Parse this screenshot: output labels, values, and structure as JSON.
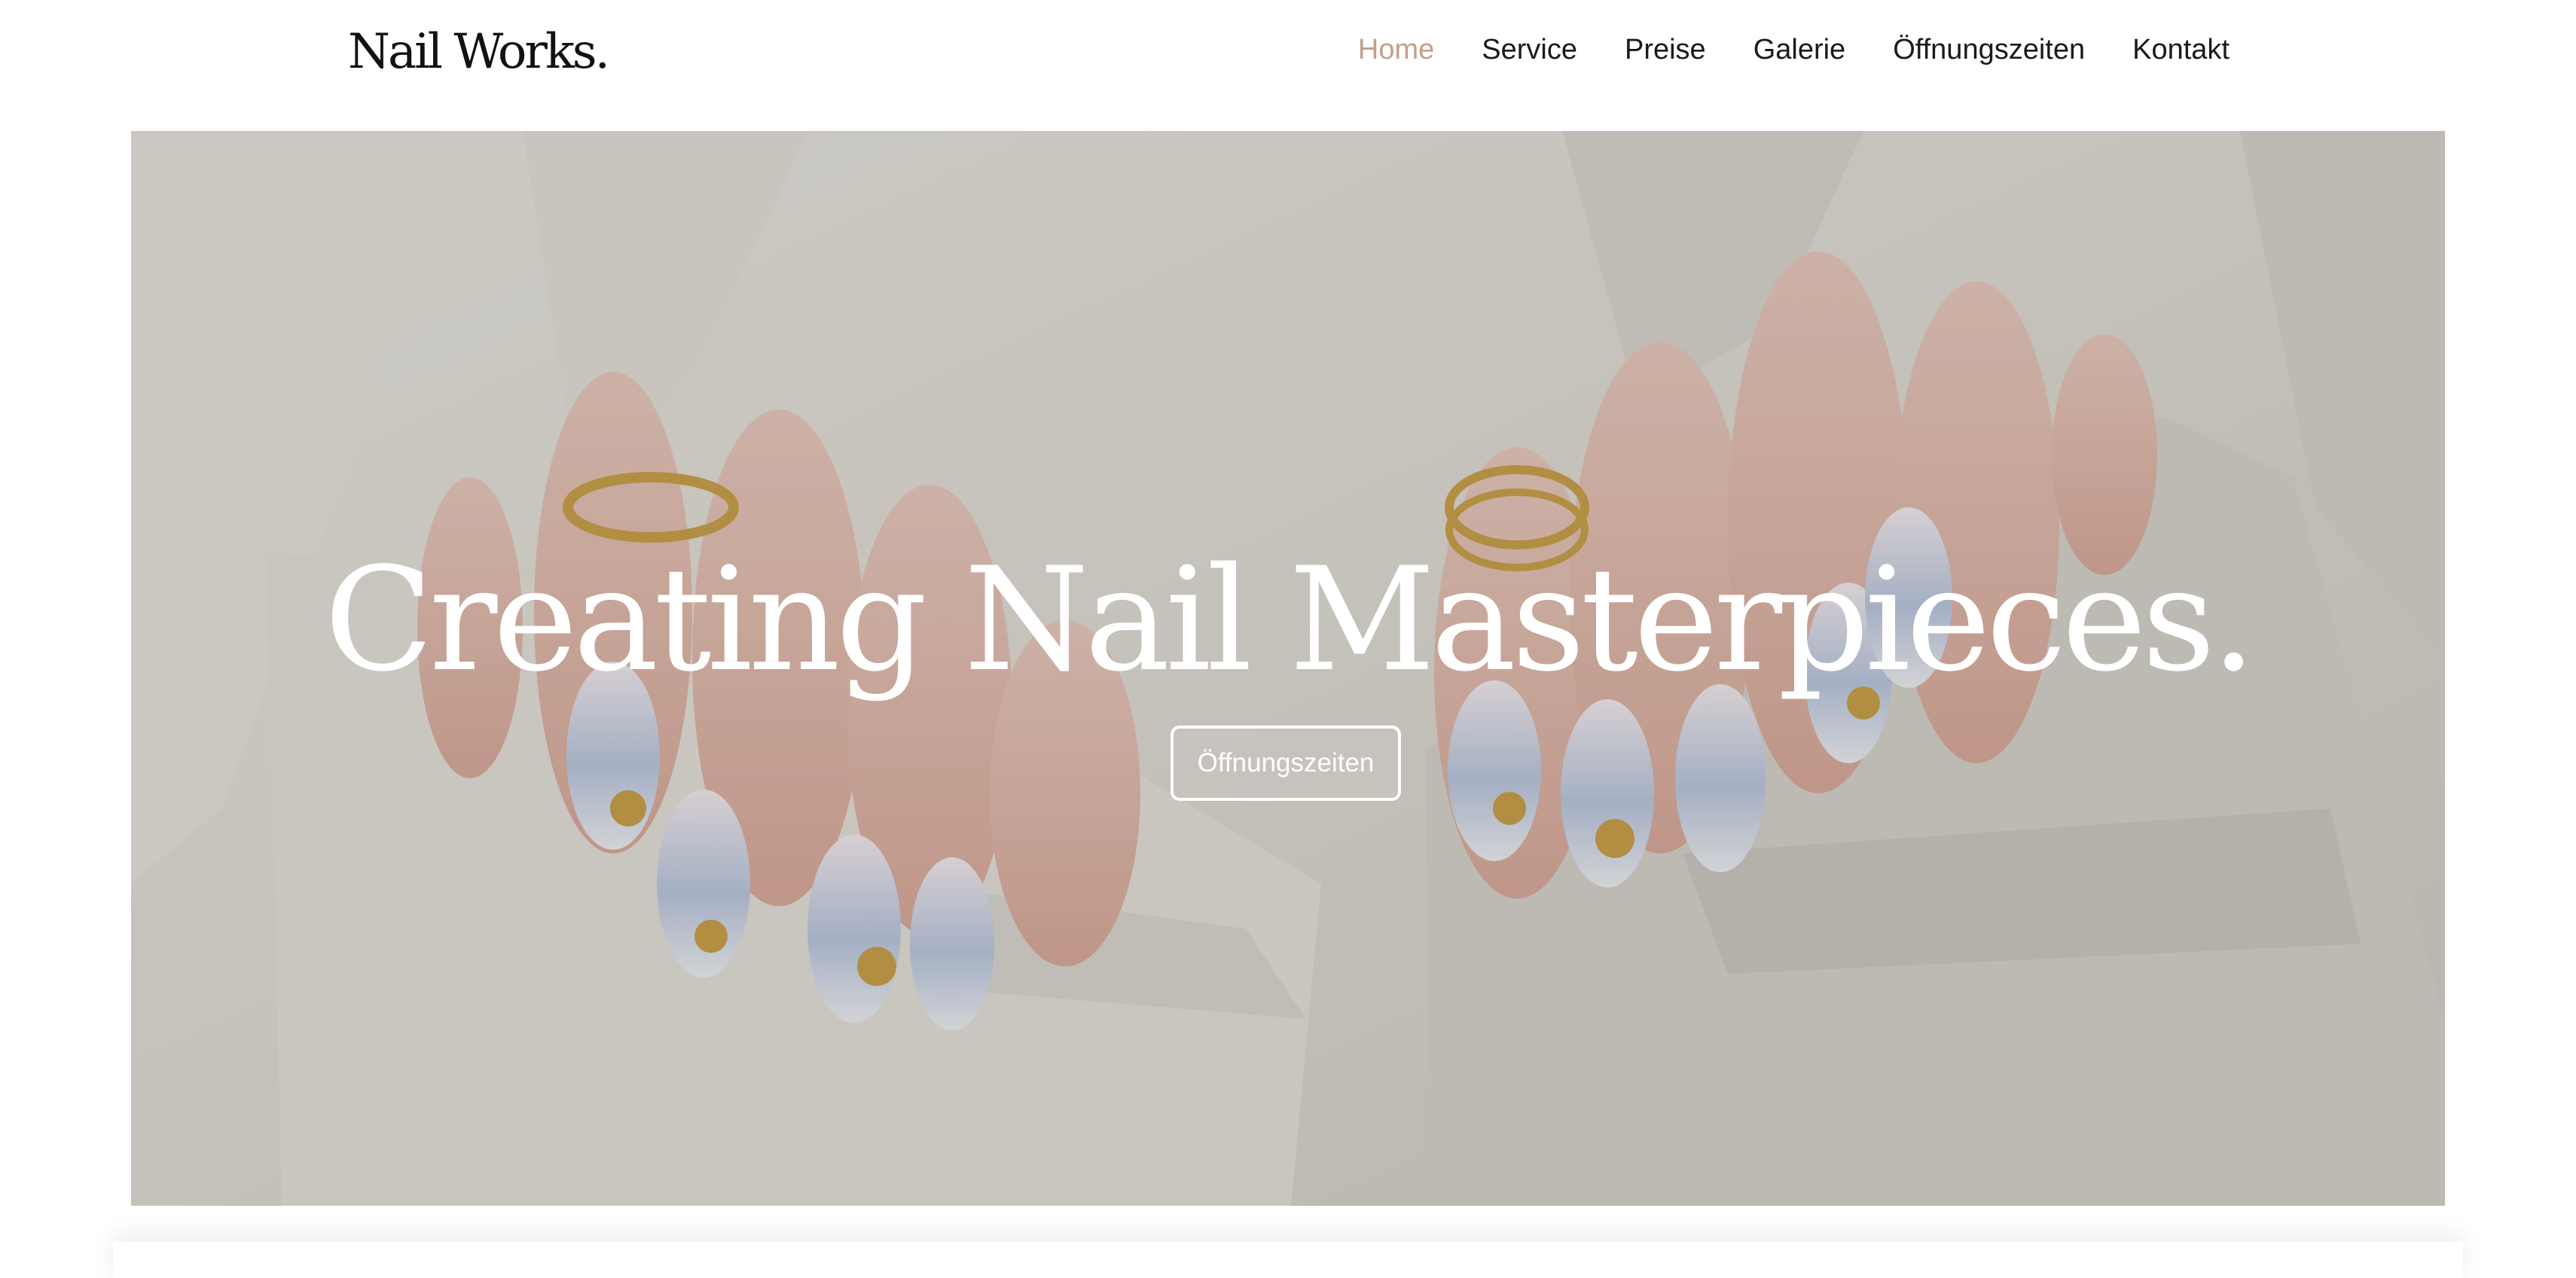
{
  "header": {
    "logo": "Nail Works.",
    "nav": [
      {
        "label": "Home",
        "active": true
      },
      {
        "label": "Service",
        "active": false
      },
      {
        "label": "Preise",
        "active": false
      },
      {
        "label": "Galerie",
        "active": false
      },
      {
        "label": "Öffnungszeiten",
        "active": false
      },
      {
        "label": "Kontakt",
        "active": false
      }
    ]
  },
  "hero": {
    "title": "Creating Nail Masterpieces.",
    "button_label": "Öffnungszeiten"
  },
  "colors": {
    "accent": "#c49f8c",
    "text": "#1a1a1a",
    "hero_text": "#ffffff"
  }
}
